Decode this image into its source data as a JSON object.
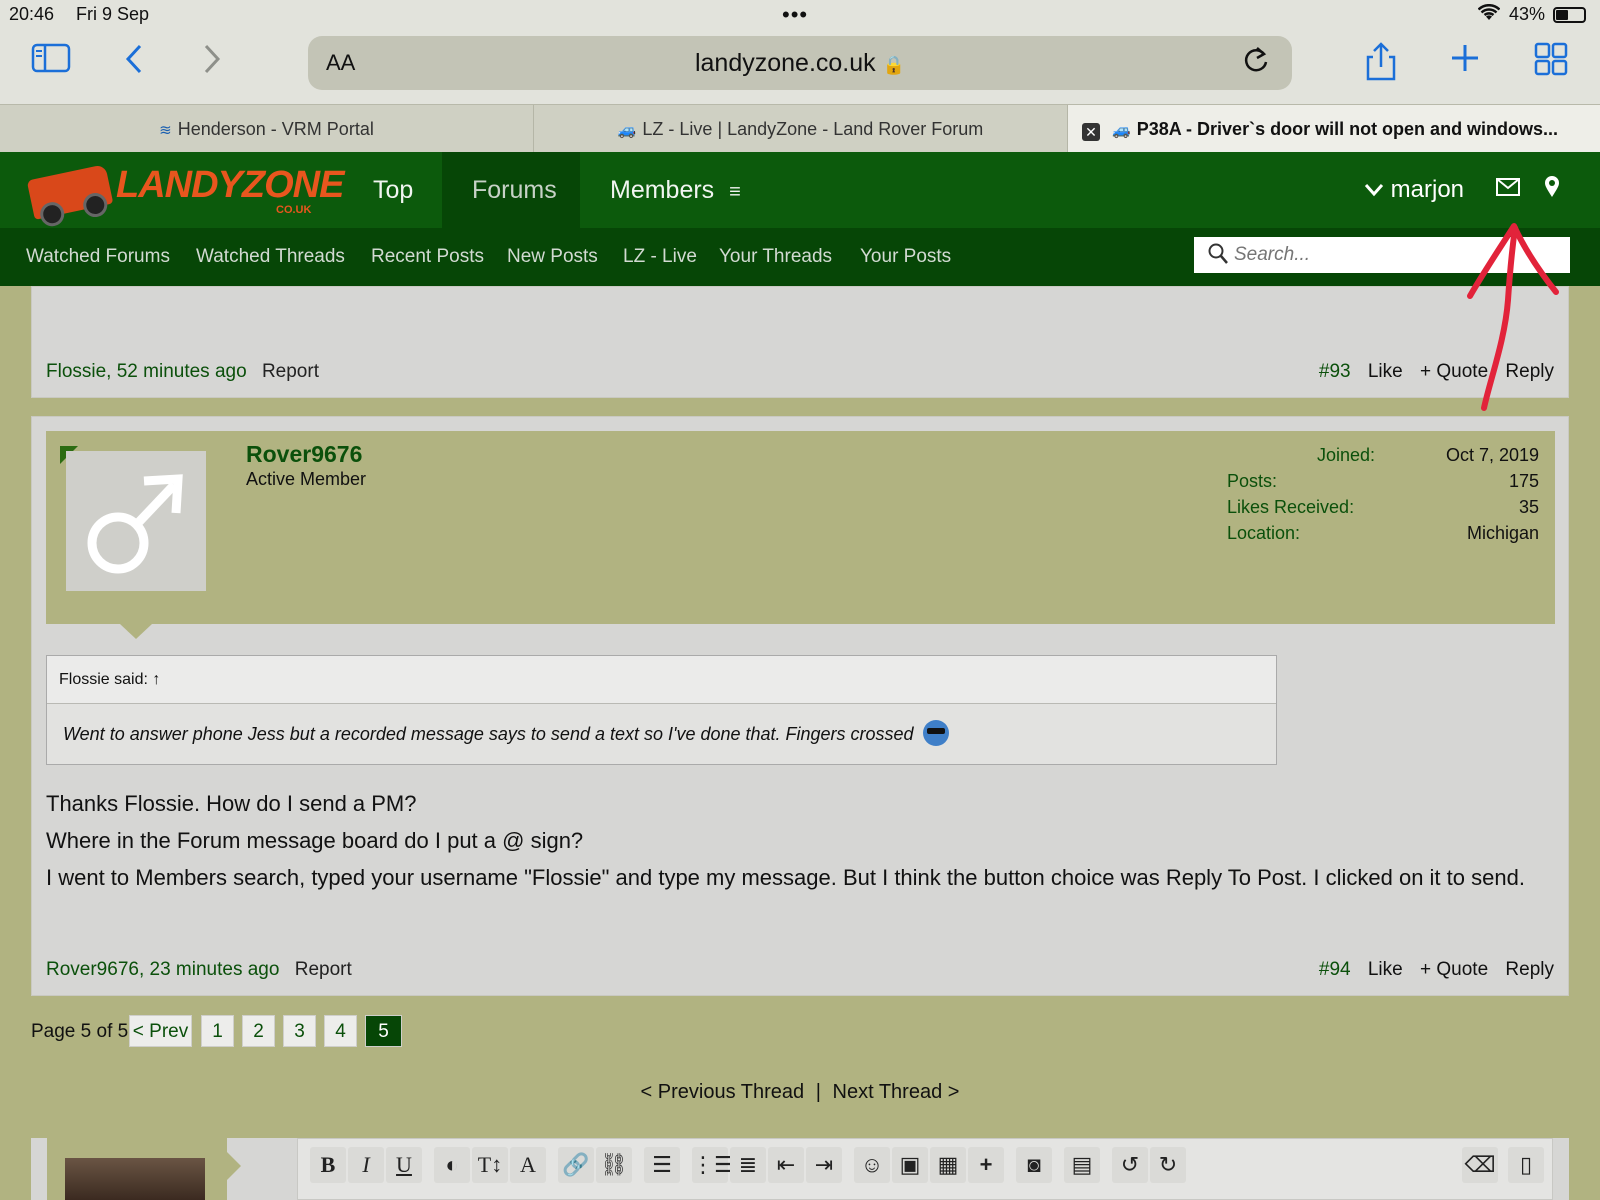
{
  "status_bar": {
    "time": "20:46",
    "date": "Fri 9 Sep",
    "battery": "43%"
  },
  "browser": {
    "text_size_label": "AA",
    "host": "landyzone.co.uk",
    "tabs": [
      {
        "title": "Henderson - VRM Portal"
      },
      {
        "title": "LZ - Live | LandyZone - Land Rover Forum"
      },
      {
        "title": "P38A - Driver`s door will not open and windows..."
      }
    ],
    "icons": [
      "sidebar-icon",
      "back-icon",
      "forward-icon",
      "lock-icon",
      "reload-icon",
      "share-icon",
      "new-tab-icon",
      "tab-overview-icon"
    ]
  },
  "site": {
    "logo_text": "LANDYZONE",
    "logo_sub": "CO.UK",
    "nav": [
      {
        "label": "Top"
      },
      {
        "label": "Forums"
      },
      {
        "label": "Members"
      }
    ],
    "username": "marjon",
    "sub_nav": [
      "Watched Forums",
      "Watched Threads",
      "Recent Posts",
      "New Posts",
      "LZ - Live",
      "Your Threads",
      "Your Posts"
    ],
    "search_placeholder": "Search..."
  },
  "prev_post": {
    "author_time": "Flossie, 52 minutes ago",
    "report": "Report",
    "number": "#93",
    "like": "Like",
    "quote": "+ Quote",
    "reply": "Reply"
  },
  "post": {
    "username": "Rover9676",
    "user_title": "Active Member",
    "stats": [
      {
        "label": "Joined:",
        "value": "Oct 7, 2019"
      },
      {
        "label": "Posts:",
        "value": "175"
      },
      {
        "label": "Likes Received:",
        "value": "35"
      },
      {
        "label": "Location:",
        "value": "Michigan"
      }
    ],
    "quote_head": "Flossie said:",
    "quote_arrow": "↑",
    "quote_text": "Went to answer phone Jess but a recorded message says to send a text so I've done that. Fingers crossed",
    "message_lines": [
      "Thanks Flossie. How do I send a PM?",
      "Where in the Forum message board do I put a @ sign?",
      "I went to Members search, typed your username \"Flossie\" and type my message. But I think the button choice was Reply To Post. I clicked on it to send."
    ],
    "author_time": "Rover9676, 23 minutes ago",
    "report": "Report",
    "number": "#94",
    "like": "Like",
    "quote": "+ Quote",
    "reply": "Reply"
  },
  "pager": {
    "label": "Page 5 of 5",
    "prev": "< Prev",
    "pages": [
      "1",
      "2",
      "3",
      "4",
      "5"
    ],
    "current": "5"
  },
  "thread_nav": {
    "prev": "< Previous Thread",
    "sep": "|",
    "next": "Next Thread >"
  },
  "editor": {
    "toolbar_icons": [
      "bold-icon",
      "italic-icon",
      "underline-icon",
      "text-color-icon",
      "font-size-icon",
      "font-family-icon",
      "link-icon",
      "unlink-icon",
      "align-icon",
      "bullet-list-icon",
      "numbered-list-icon",
      "outdent-icon",
      "indent-icon",
      "smilie-icon",
      "image-icon",
      "media-icon",
      "insert-icon",
      "photo-upload-icon",
      "save-draft-icon",
      "undo-icon",
      "redo-icon",
      "remove-format-icon",
      "source-icon"
    ],
    "bold_glyph": "B",
    "italic_glyph": "I",
    "underline_glyph": "U"
  },
  "colors": {
    "site_green": "#0c5a0c",
    "page_olive": "#b1b381",
    "logo_orange": "#e8561e",
    "annotation_red": "#e2233a"
  }
}
